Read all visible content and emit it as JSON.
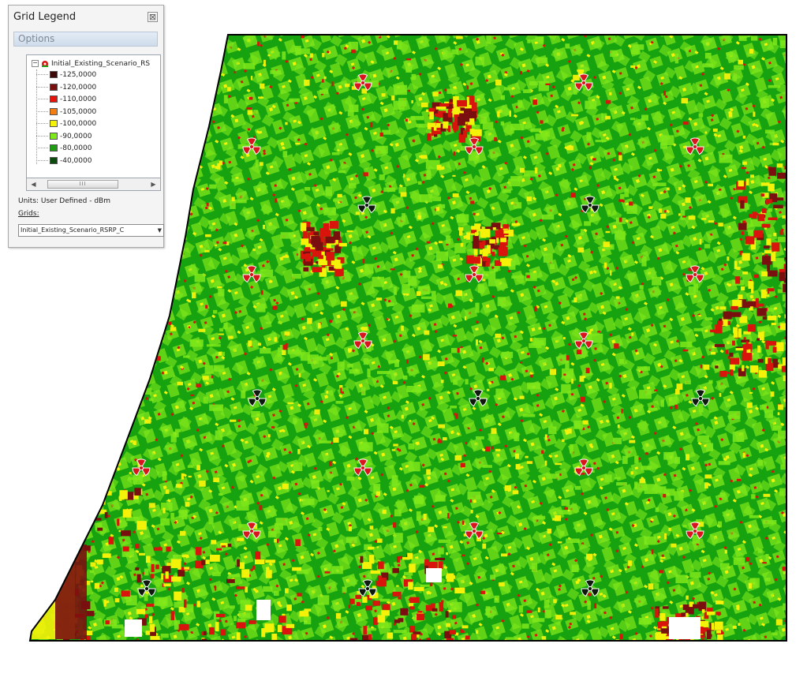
{
  "legend": {
    "title": "Grid Legend",
    "close_glyph": "⊠",
    "options_label": "Options",
    "tree_root_label": "Initial_Existing_Scenario_RS",
    "entries": [
      {
        "label": "-125,0000",
        "color": "#3d0a0a"
      },
      {
        "label": "-120,0000",
        "color": "#7a0f0f"
      },
      {
        "label": "-110,0000",
        "color": "#e8140c"
      },
      {
        "label": "-105,0000",
        "color": "#f27d10"
      },
      {
        "label": "-100,0000",
        "color": "#f5f20a"
      },
      {
        "label": "-90,0000",
        "color": "#7fe81a"
      },
      {
        "label": "-80,0000",
        "color": "#1f9e14"
      },
      {
        "label": "-40,0000",
        "color": "#0d4a0d"
      }
    ],
    "scroll_thumb_text": "III",
    "units_text": "Units: User Defined - dBm",
    "grids_label": "Grids:",
    "grids_value": "Initial_Existing_Scenario_RSRP_C"
  },
  "map": {
    "base_color": "#16a30f",
    "light_color": "#7fe81a",
    "yellow_color": "#f5f20a",
    "red_color": "#d8140c",
    "dark_red_color": "#7a0f0f",
    "border_color": "#000000",
    "red_site_icon": "radiation-trefoil-red-icon",
    "black_site_icon": "radiation-trefoil-black-icon"
  }
}
